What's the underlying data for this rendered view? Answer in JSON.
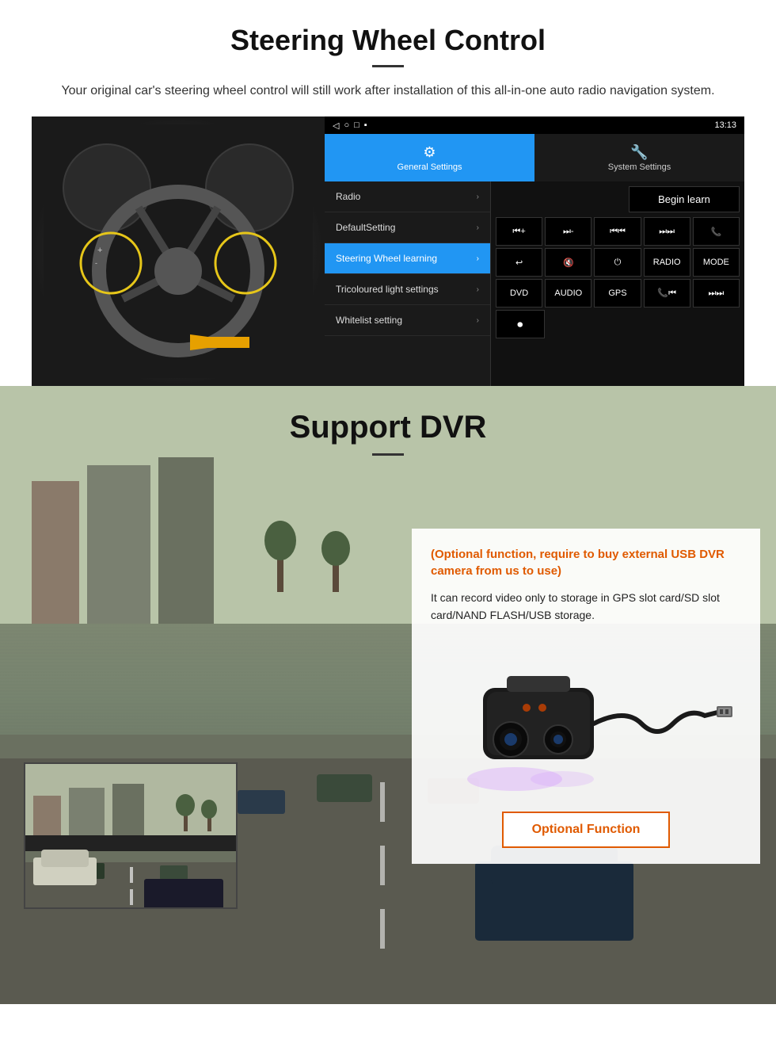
{
  "section1": {
    "title": "Steering Wheel Control",
    "subtitle": "Your original car's steering wheel control will still work after installation of this all-in-one auto radio navigation system.",
    "status_bar": {
      "time": "13:13",
      "nav_icons": [
        "◁",
        "○",
        "□",
        "▪"
      ]
    },
    "tabs": {
      "general": "General Settings",
      "system": "System Settings"
    },
    "menu_items": [
      {
        "label": "Radio",
        "active": false
      },
      {
        "label": "DefaultSetting",
        "active": false
      },
      {
        "label": "Steering Wheel learning",
        "active": true
      },
      {
        "label": "Tricoloured light settings",
        "active": false
      },
      {
        "label": "Whitelist setting",
        "active": false
      }
    ],
    "begin_learn_label": "Begin learn",
    "control_buttons": [
      {
        "label": "⏮+",
        "row": 1
      },
      {
        "label": "⏭-",
        "row": 1
      },
      {
        "label": "⏮⏮",
        "row": 1
      },
      {
        "label": "⏭⏭",
        "row": 1
      },
      {
        "label": "📞",
        "row": 1
      },
      {
        "label": "↩",
        "row": 2
      },
      {
        "label": "🔇",
        "row": 2
      },
      {
        "label": "⏻",
        "row": 2
      },
      {
        "label": "RADIO",
        "row": 2
      },
      {
        "label": "MODE",
        "row": 2
      },
      {
        "label": "DVD",
        "row": 3
      },
      {
        "label": "AUDIO",
        "row": 3
      },
      {
        "label": "GPS",
        "row": 3
      },
      {
        "label": "📞⏮",
        "row": 3
      },
      {
        "label": "⏭⏭",
        "row": 3
      },
      {
        "label": "⏺",
        "row": 4
      }
    ]
  },
  "section2": {
    "title": "Support DVR",
    "optional_text": "(Optional function, require to buy external USB DVR camera from us to use)",
    "description": "It can record video only to storage in GPS slot card/SD slot card/NAND FLASH/USB storage.",
    "optional_function_label": "Optional Function"
  }
}
